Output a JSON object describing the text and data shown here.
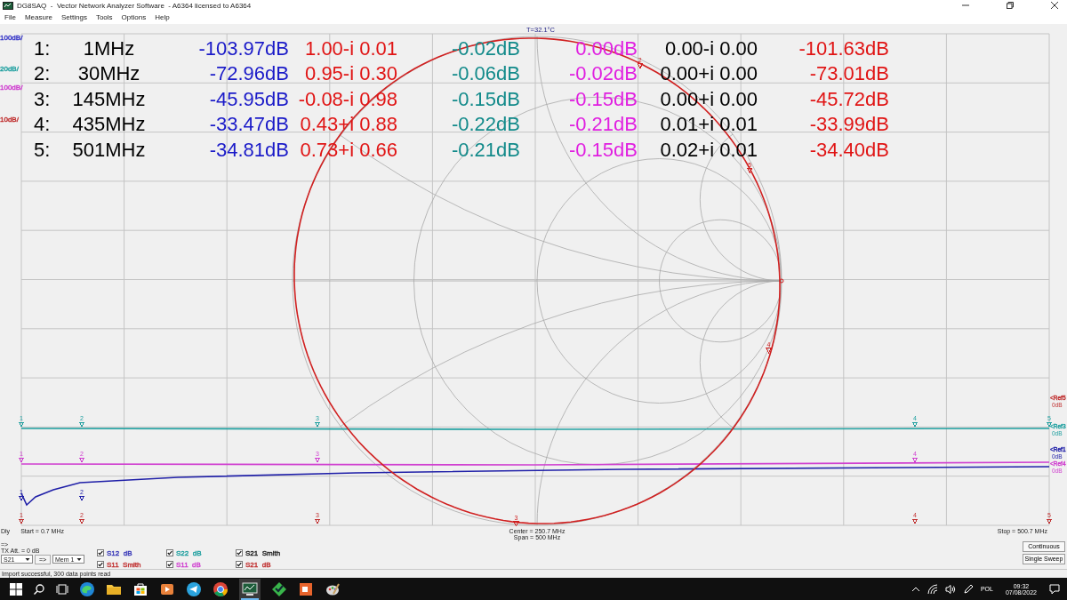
{
  "window": {
    "title": "DG8SAQ  -  Vector Network Analyzer Software  - A6364 licensed to A6364"
  },
  "menu": [
    "File",
    "Measure",
    "Settings",
    "Tools",
    "Options",
    "Help"
  ],
  "scale_labels": [
    {
      "text": "100dB/",
      "color": "#3838c8"
    },
    {
      "text": "20dB/",
      "color": "#20a0a0"
    },
    {
      "text": "100dB/",
      "color": "#d040d0"
    },
    {
      "text": "10dB/",
      "color": "#c03030"
    }
  ],
  "temperature": "T=32.1°C",
  "marker_table": {
    "columns": [
      {
        "color": "#000000"
      },
      {
        "color": "#000000"
      },
      {
        "color": "#1a1ac8"
      },
      {
        "color": "#e01414"
      },
      {
        "color": "#128a8a"
      },
      {
        "color": "#e020e0"
      },
      {
        "color": "#000000"
      },
      {
        "color": "#e01414"
      }
    ],
    "rows": [
      {
        "cells": [
          "1:",
          "1MHz",
          "-103.97dB",
          "1.00-i 0.01",
          "-0.02dB",
          "0.00dB",
          "0.00-i 0.00",
          "-101.63dB"
        ]
      },
      {
        "cells": [
          "2:",
          "30MHz",
          "-72.96dB",
          "0.95-i 0.30",
          "-0.06dB",
          "-0.02dB",
          "0.00+i 0.00",
          "-73.01dB"
        ]
      },
      {
        "cells": [
          "3:",
          "145MHz",
          "-45.95dB",
          "-0.08-i 0.98",
          "-0.15dB",
          "-0.15dB",
          "0.00+i 0.00",
          "-45.72dB"
        ]
      },
      {
        "cells": [
          "4:",
          "435MHz",
          "-33.47dB",
          "0.43+i 0.88",
          "-0.22dB",
          "-0.21dB",
          "0.01+i 0.01",
          "-33.99dB"
        ]
      },
      {
        "cells": [
          "5:",
          "501MHz",
          "-34.81dB",
          "0.73+i 0.66",
          "-0.21dB",
          "-0.15dB",
          "0.02+i 0.01",
          "-34.40dB"
        ]
      }
    ]
  },
  "line_markers": [
    {
      "color": "#20a0a0",
      "labels": [
        "1",
        "2",
        "3",
        "4",
        "5"
      ]
    },
    {
      "color": "#d040d0",
      "labels": [
        "1",
        "2",
        "3",
        "4"
      ]
    },
    {
      "color": "#2020a8",
      "labels": [
        "1",
        "2"
      ]
    },
    {
      "color": "#c03030",
      "labels": [
        "1",
        "2",
        "3",
        "4",
        "5"
      ]
    }
  ],
  "smith_markers": {
    "color": "#d02020",
    "labels": [
      "2",
      "3",
      "4",
      "5"
    ]
  },
  "ref_labels": [
    {
      "text": "<Ref5",
      "value": "0dB",
      "color": "#c03030"
    },
    {
      "text": "<Ref3",
      "value": "0dB",
      "color": "#20a0a0"
    },
    {
      "text": "<Ref1",
      "value": "0dB",
      "color": "#2020a8"
    },
    {
      "text": "<Ref4",
      "value": "0dB",
      "color": "#d040d0"
    }
  ],
  "sweep": {
    "delay": "Dly",
    "start": "Start = 0.7 MHz",
    "center": "Center = 250.7 MHz",
    "span": "Span = 500 MHz",
    "stop": "Stop = 500.7 MHz"
  },
  "controls": {
    "arrow": "=>",
    "tx_att": "TX Att.  = 0 dB",
    "param_select": "S21",
    "copy_button": "=>",
    "mem_select": "Mem 1"
  },
  "display_checks": [
    {
      "param": "S12",
      "mode": "dB",
      "checked": true,
      "color": "#3838b8"
    },
    {
      "param": "S22",
      "mode": "dB",
      "checked": true,
      "color": "#20a0a0"
    },
    {
      "param": "S21",
      "mode": "Smith",
      "checked": true,
      "color": "#202020"
    },
    {
      "param": "S11",
      "mode": "Smith",
      "checked": true,
      "color": "#c03030"
    },
    {
      "param": "S11",
      "mode": "dB",
      "checked": true,
      "color": "#d040d0"
    },
    {
      "param": "S21",
      "mode": "dB",
      "checked": true,
      "color": "#c03030"
    }
  ],
  "buttons": [
    "Continuous",
    "Single Sweep"
  ],
  "status_bar": "Import successful, 300 data points read",
  "taskbar": {
    "language": "POL",
    "time": "09:32",
    "date": "07/08/2022"
  }
}
